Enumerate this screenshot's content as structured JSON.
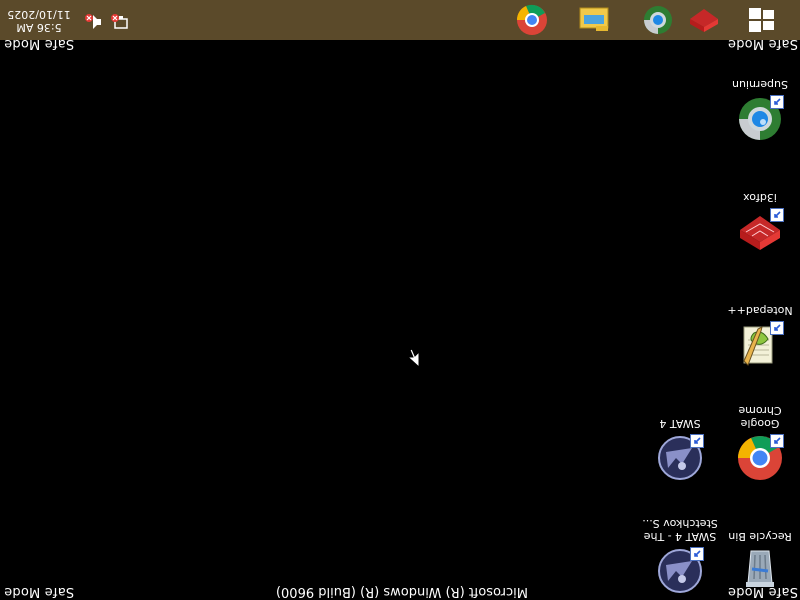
{
  "safe_mode": {
    "top_left": "Safe Mode",
    "top_right": "Safe Mode",
    "bottom_left": "Safe Mode",
    "bottom_right": "Safe Mode"
  },
  "build_text": "Microsoft (R) Windows (R) (Build 9600)",
  "desktop_icons": [
    {
      "label": "Recycle Bin",
      "icon": "recycle-bin-icon"
    },
    {
      "label": "Google Chrome",
      "icon": "chrome-icon"
    },
    {
      "label": "Notepad++",
      "icon": "notepad-plus-plus-icon"
    },
    {
      "label": "i3dfox",
      "icon": "i3dfox-icon"
    },
    {
      "label": "Superniun",
      "icon": "superniun-icon"
    },
    {
      "label": "SWAT 4 - The Stetchkov S...",
      "icon": "swat4-icon"
    },
    {
      "label": "SWAT 4",
      "icon": "swat4-icon"
    }
  ],
  "taskbar": {
    "clock_time": "5:36 AM",
    "clock_date": "11/10/2025",
    "items": [
      "start-windows-icon",
      "i3dfox-icon",
      "superniun-icon",
      "file-explorer-icon",
      "chrome-icon"
    ],
    "tray": [
      "network-error-icon",
      "volume-muted-icon"
    ]
  },
  "colors": {
    "taskbar": "#5b4a2a",
    "desktop": "#000000"
  }
}
